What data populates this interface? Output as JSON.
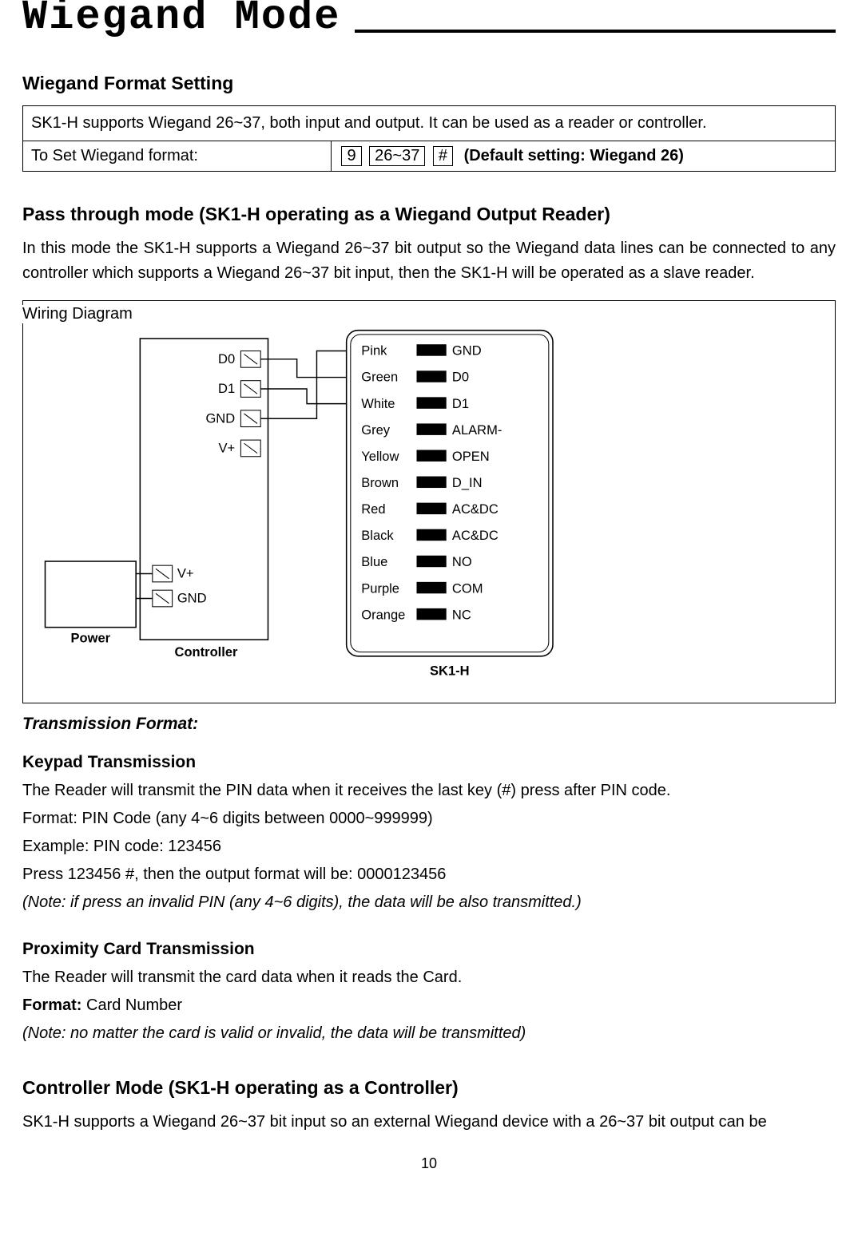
{
  "page_number": "10",
  "title": "Wiegand Mode",
  "section1": {
    "heading": "Wiegand Format Setting",
    "desc": "SK1-H supports Wiegand 26~37, both input and output. It can be used as a reader or controller.",
    "row2_left": "To Set Wiegand format:",
    "seq": {
      "b1": "9",
      "b2": "26~37",
      "b3": "#",
      "note": "(Default setting: Wiegand 26)"
    }
  },
  "section2": {
    "heading": "Pass through mode (SK1-H operating as a Wiegand Output Reader)",
    "para": "In this mode the SK1-H supports a Wiegand 26~37 bit output so the Wiegand data lines can be connected to any controller which supports a Wiegand 26~37 bit input, then the SK1-H will be operated as a slave reader.",
    "wiring_label": "Wiring Diagram"
  },
  "diagram": {
    "device_label": "SK1-H",
    "controller_label": "Controller",
    "power_label": "Power",
    "ctrl_pins": [
      "D0",
      "D1",
      "GND",
      "V+"
    ],
    "ctrl_power_pins": [
      "V+",
      "GND"
    ],
    "wires": [
      {
        "color": "Pink",
        "term": "GND"
      },
      {
        "color": "Green",
        "term": "D0"
      },
      {
        "color": "White",
        "term": "D1"
      },
      {
        "color": "Grey",
        "term": "ALARM-"
      },
      {
        "color": "Yellow",
        "term": "OPEN"
      },
      {
        "color": "Brown",
        "term": "D_IN"
      },
      {
        "color": "Red",
        "term": "AC&DC"
      },
      {
        "color": "Black",
        "term": "AC&DC"
      },
      {
        "color": "Blue",
        "term": "NO"
      },
      {
        "color": "Purple",
        "term": "COM"
      },
      {
        "color": "Orange",
        "term": "NC"
      }
    ]
  },
  "transmission": {
    "heading": "Transmission Format:",
    "keypad_h": "Keypad Transmission",
    "keypad_l1": "The Reader will transmit the PIN data when it receives the last key (#) press after PIN code.",
    "keypad_l2_lead": "Format",
    "keypad_l2_rest": ": PIN Code (any 4~6 digits between 0000~999999)",
    "keypad_l3_lead": "Example",
    "keypad_l3_rest": ": PIN code: 123456",
    "keypad_l4": "Press 123456 #, then the output format will be: 0000123456",
    "keypad_note": "(Note: if press an invalid PIN (any 4~6 digits), the data will be also transmitted.)",
    "prox_h": "Proximity Card Transmission",
    "prox_l1": "The Reader will transmit the card data when it reads the Card.",
    "prox_l2_lead": "Format:",
    "prox_l2_rest": " Card Number",
    "prox_note": "(Note: no matter the card is valid or invalid, the data will be transmitted)"
  },
  "section3": {
    "heading": "Controller Mode (SK1-H operating as a Controller)",
    "para": "SK1-H supports a Wiegand 26~37 bit input so an external Wiegand device with a 26~37 bit output can be"
  }
}
